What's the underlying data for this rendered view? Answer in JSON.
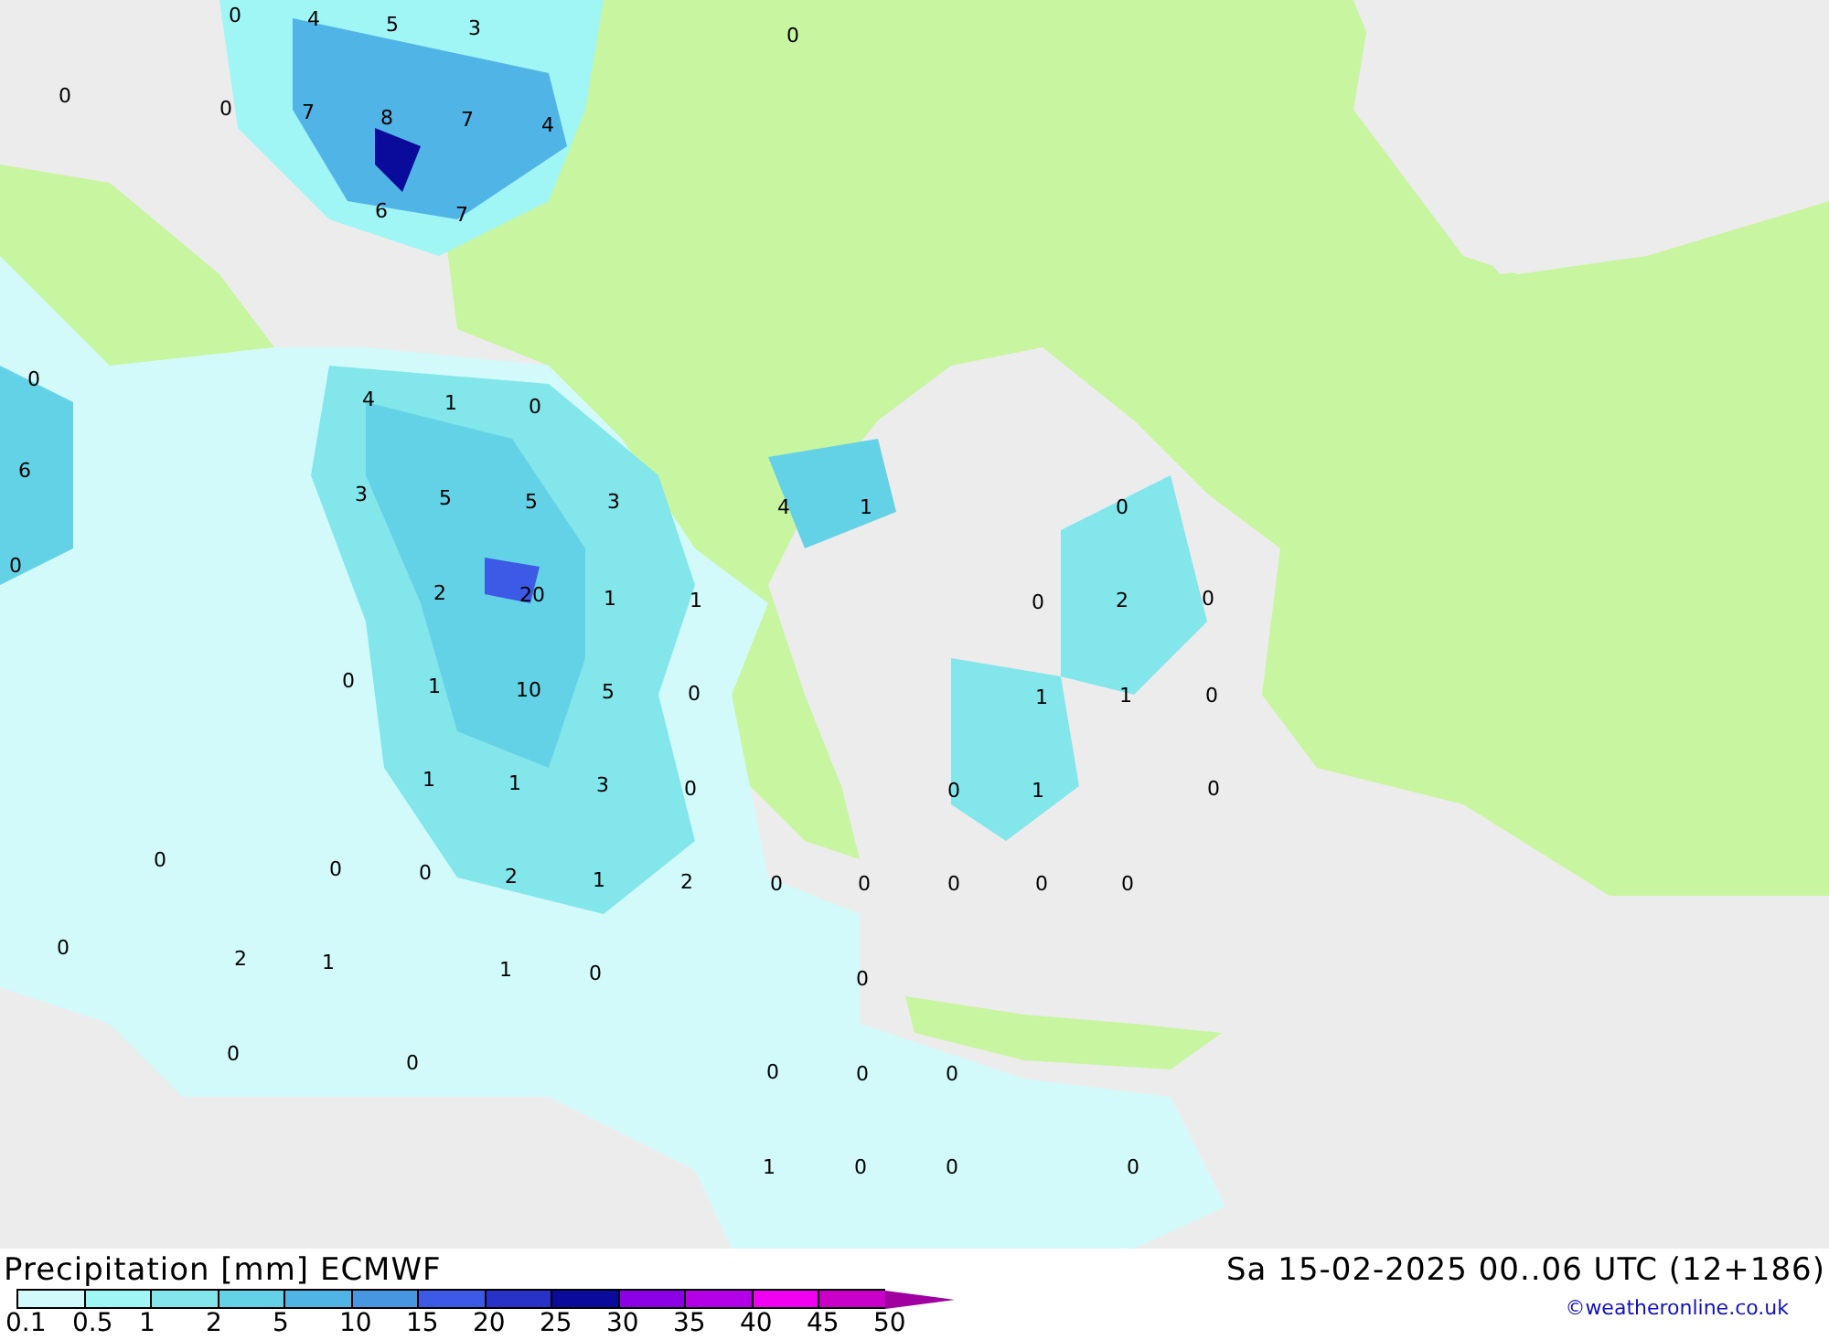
{
  "map": {
    "labels": [
      "0",
      "4",
      "5",
      "3",
      "0",
      "0",
      "0",
      "7",
      "8",
      "7",
      "4",
      "6",
      "7",
      "0",
      "4",
      "1",
      "0",
      "6",
      "3",
      "5",
      "5",
      "3",
      "4",
      "1",
      "0",
      "0",
      "2",
      "20",
      "1",
      "1",
      "0",
      "2",
      "0",
      "0",
      "1",
      "10",
      "5",
      "0",
      "1",
      "1",
      "0",
      "1",
      "1",
      "3",
      "0",
      "0",
      "1",
      "0",
      "0",
      "0",
      "0",
      "2",
      "1",
      "2",
      "0",
      "0",
      "0",
      "0",
      "0",
      "0",
      "2",
      "1",
      "1",
      "0",
      "0",
      "0",
      "0",
      "0",
      "0",
      "0",
      "1",
      "0",
      "0",
      "0"
    ]
  },
  "footer": {
    "title": "Precipitation [mm] ECMWF",
    "datetime": "Sa 15-02-2025 00..06 UTC (12+186)",
    "credit": "©weatheronline.co.uk",
    "legend": [
      {
        "label": "0.1",
        "color": "#d2fafa"
      },
      {
        "label": "0.5",
        "color": "#a0f5f5"
      },
      {
        "label": "1",
        "color": "#82e6eb"
      },
      {
        "label": "2",
        "color": "#64d2e6"
      },
      {
        "label": "5",
        "color": "#50b4e6"
      },
      {
        "label": "10",
        "color": "#4696e1"
      },
      {
        "label": "15",
        "color": "#3c5ae6"
      },
      {
        "label": "20",
        "color": "#2832c8"
      },
      {
        "label": "25",
        "color": "#0a0a9b"
      },
      {
        "label": "30",
        "color": "#8c00e6"
      },
      {
        "label": "35",
        "color": "#b400e6"
      },
      {
        "label": "40",
        "color": "#f000f0"
      },
      {
        "label": "45",
        "color": "#c800c8"
      },
      {
        "label": "50",
        "color": "#a000a0"
      }
    ]
  }
}
